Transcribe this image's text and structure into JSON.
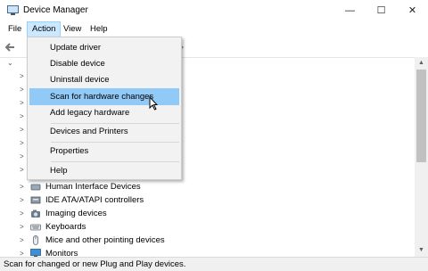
{
  "window": {
    "title": "Device Manager",
    "controls": {
      "minimize": "—",
      "maximize": "☐",
      "close": "✕"
    }
  },
  "menubar": {
    "items": [
      "File",
      "Action",
      "View",
      "Help"
    ],
    "active": "Action"
  },
  "action_menu": {
    "items": [
      "Update driver",
      "Disable device",
      "Uninstall device",
      "Scan for hardware changes",
      "Add legacy hardware",
      "Devices and Printers",
      "Properties",
      "Help"
    ],
    "highlighted": "Scan for hardware changes"
  },
  "tree": {
    "visible_categories": [
      {
        "label": "Human Interface Devices",
        "icon": "hid-icon"
      },
      {
        "label": "IDE ATA/ATAPI controllers",
        "icon": "ide-controller-icon"
      },
      {
        "label": "Imaging devices",
        "icon": "camera-icon"
      },
      {
        "label": "Keyboards",
        "icon": "keyboard-icon"
      },
      {
        "label": "Mice and other pointing devices",
        "icon": "mouse-icon"
      },
      {
        "label": "Monitors",
        "icon": "monitor-icon"
      }
    ],
    "expand_glyph": ">"
  },
  "statusbar": {
    "text": "Scan for changed or new Plug and Play devices."
  },
  "colors": {
    "menu_highlight": "#91c9f7",
    "menu_active": "#cce8ff",
    "menu_background": "#f2f2f2"
  }
}
